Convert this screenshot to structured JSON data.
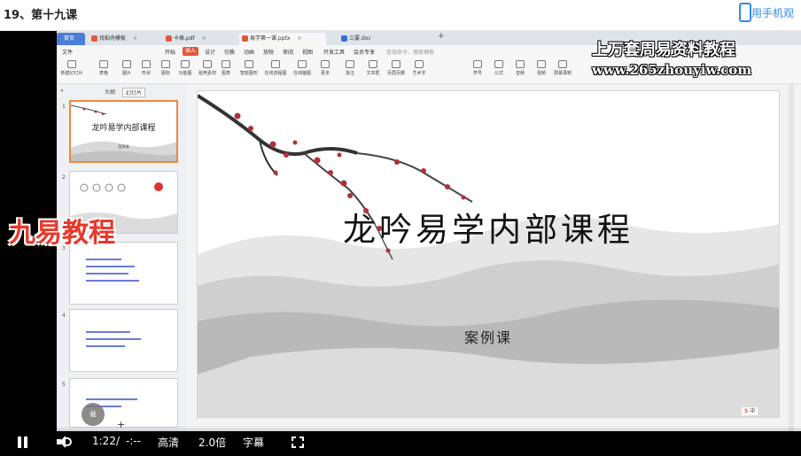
{
  "page": {
    "title": "19、第十九课",
    "phone_label": "用手机观"
  },
  "wps": {
    "tabs": [
      {
        "label": "首页",
        "color": "#4a7ed9"
      },
      {
        "label": "找稻壳模板",
        "color": "#e2573a"
      },
      {
        "label": "卡格.pdf",
        "color": "#e2573a"
      },
      {
        "label": "易学第一课.pptx",
        "color": "#e2573a"
      },
      {
        "label": "三要.doc",
        "color": "#2f6fd6"
      }
    ],
    "menus": [
      "文件",
      "开始",
      "插入",
      "设计",
      "切换",
      "动画",
      "放映",
      "审阅",
      "视图",
      "开发工具",
      "会员专享"
    ],
    "active_menu": "插入",
    "search_placeholder": "查找命令、搜索模板",
    "tools": [
      "新建幻灯片",
      "表格",
      "图片",
      "形状",
      "图标",
      "功能图",
      "稻壳素材",
      "图表",
      "智能图形",
      "在线流程图",
      "在线脑图",
      "更多",
      "批注",
      "文本框",
      "页眉页脚",
      "艺术字",
      "符号",
      "公式",
      "音频",
      "视频",
      "屏幕录制"
    ],
    "panel_tabs": [
      "大纲",
      "幻灯片"
    ],
    "thumb_title": "龙吟易学内部课程",
    "thumb_sub": "案例课",
    "slide_numbers": [
      "1",
      "2",
      "3",
      "4",
      "5"
    ],
    "add_slide": "+"
  },
  "slide": {
    "title": "龙吟易学内部课程",
    "subtitle": "案例课"
  },
  "ime": {
    "label": "中"
  },
  "watermark": {
    "line1": "上万套周易资料教程",
    "line2": "www.265zhouyiw.com",
    "logo": "九易教程"
  },
  "screenshot_btn": "截",
  "player": {
    "time": "1:22",
    "separator": "/",
    "duration": "-:--",
    "quality": "高清",
    "speed": "2.0倍",
    "subtitle": "字幕"
  }
}
